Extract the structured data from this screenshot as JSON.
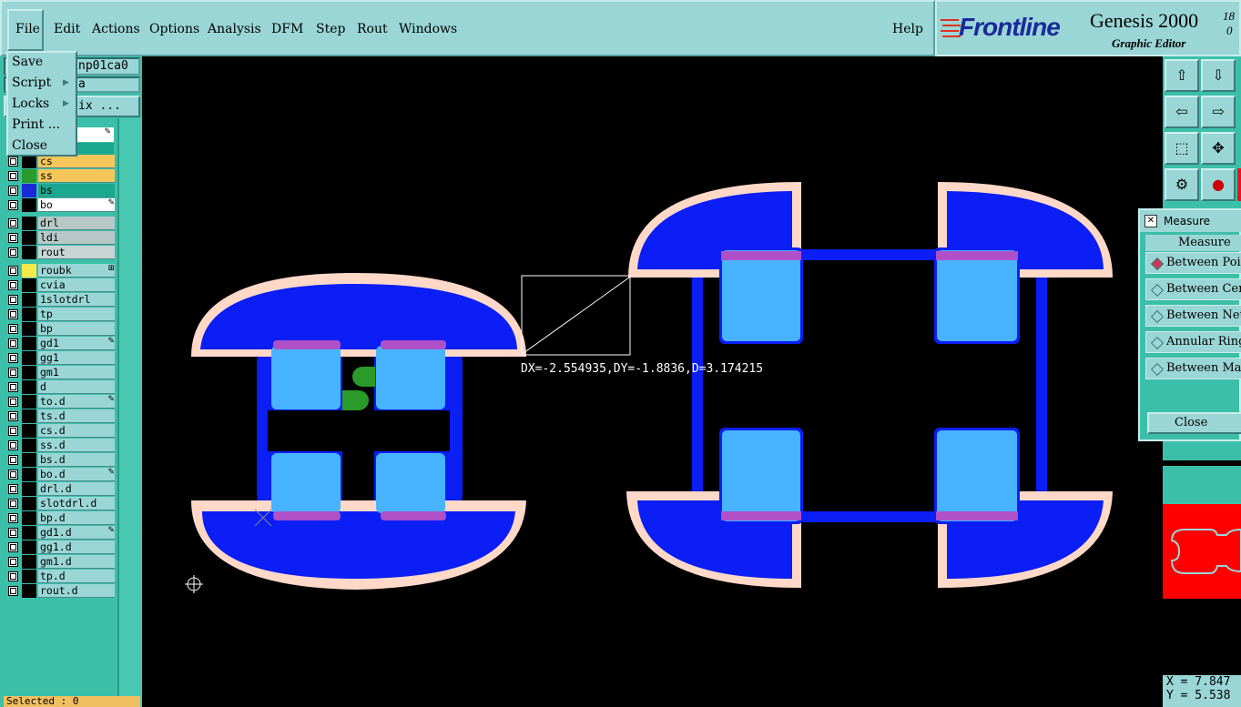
{
  "menubar": {
    "items": [
      {
        "label": "File",
        "underline": "F"
      },
      {
        "label": "Edit",
        "underline": "E"
      },
      {
        "label": "Actions",
        "underline": "A"
      },
      {
        "label": "Options",
        "underline": "O"
      },
      {
        "label": "Analysis",
        "underline": "A"
      },
      {
        "label": "DFM",
        "underline": "D"
      },
      {
        "label": "Step",
        "underline": "S"
      },
      {
        "label": "Rout",
        "underline": "R"
      },
      {
        "label": "Windows",
        "underline": "W"
      }
    ],
    "help": "Help"
  },
  "brand": {
    "logo": "Frontline",
    "product": "Genesis 2000",
    "subtitle": "Graphic Editor",
    "version_top": "18",
    "version_bottom": "0"
  },
  "file_menu": {
    "items": [
      {
        "label": "Save",
        "submenu": false
      },
      {
        "label": "Script",
        "submenu": true
      },
      {
        "label": "Locks",
        "submenu": true
      },
      {
        "label": "Print ...",
        "submenu": false
      },
      {
        "label": "Close",
        "submenu": false
      }
    ]
  },
  "left_panel": {
    "job_field": "np01ca0",
    "step_field": "a",
    "matrix_button": "ix ...",
    "selected_text": "Selected : 0"
  },
  "layers": [
    {
      "name": "cs",
      "color": "#000000",
      "bg": "#f5c65a",
      "flag": ""
    },
    {
      "name": "ss",
      "color": "#2a9a2a",
      "bg": "#f5c65a",
      "flag": ""
    },
    {
      "name": "bs",
      "color": "#1a2ad8",
      "bg": "#1aa890",
      "flag": ""
    },
    {
      "name": "bo",
      "color": "#000000",
      "bg": "#ffffff",
      "flag": "✎"
    },
    {
      "name": "drl",
      "color": "#000000",
      "bg": "#b8c8c8",
      "flag": ""
    },
    {
      "name": "ldi",
      "color": "#000000",
      "bg": "#b8c8c8",
      "flag": ""
    },
    {
      "name": "rout",
      "color": "#000000",
      "bg": "#c8d4d4",
      "flag": ""
    },
    {
      "name": "roubk",
      "color": "#f5e84a",
      "bg": "#9ad6d6",
      "flag": "⊞"
    },
    {
      "name": "cvia",
      "color": "#000000",
      "bg": "#9ad6d6",
      "flag": ""
    },
    {
      "name": "1slotdrl",
      "color": "#000000",
      "bg": "#9ad6d6",
      "flag": ""
    },
    {
      "name": "tp",
      "color": "#000000",
      "bg": "#9ad6d6",
      "flag": ""
    },
    {
      "name": "bp",
      "color": "#000000",
      "bg": "#9ad6d6",
      "flag": ""
    },
    {
      "name": "gd1",
      "color": "#000000",
      "bg": "#9ad6d6",
      "flag": "✎"
    },
    {
      "name": "gg1",
      "color": "#000000",
      "bg": "#9ad6d6",
      "flag": ""
    },
    {
      "name": "gm1",
      "color": "#000000",
      "bg": "#9ad6d6",
      "flag": ""
    },
    {
      "name": "d",
      "color": "#000000",
      "bg": "#9ad6d6",
      "flag": ""
    },
    {
      "name": "to.d",
      "color": "#000000",
      "bg": "#9ad6d6",
      "flag": "✎"
    },
    {
      "name": "ts.d",
      "color": "#000000",
      "bg": "#9ad6d6",
      "flag": ""
    },
    {
      "name": "cs.d",
      "color": "#000000",
      "bg": "#9ad6d6",
      "flag": ""
    },
    {
      "name": "ss.d",
      "color": "#000000",
      "bg": "#9ad6d6",
      "flag": ""
    },
    {
      "name": "bs.d",
      "color": "#000000",
      "bg": "#9ad6d6",
      "flag": ""
    },
    {
      "name": "bo.d",
      "color": "#000000",
      "bg": "#9ad6d6",
      "flag": "✎"
    },
    {
      "name": "drl.d",
      "color": "#000000",
      "bg": "#9ad6d6",
      "flag": ""
    },
    {
      "name": "slotdrl.d",
      "color": "#000000",
      "bg": "#9ad6d6",
      "flag": ""
    },
    {
      "name": "bp.d",
      "color": "#000000",
      "bg": "#9ad6d6",
      "flag": ""
    },
    {
      "name": "gd1.d",
      "color": "#000000",
      "bg": "#9ad6d6",
      "flag": "✎"
    },
    {
      "name": "gg1.d",
      "color": "#000000",
      "bg": "#9ad6d6",
      "flag": ""
    },
    {
      "name": "gm1.d",
      "color": "#000000",
      "bg": "#9ad6d6",
      "flag": ""
    },
    {
      "name": "tp.d",
      "color": "#000000",
      "bg": "#9ad6d6",
      "flag": ""
    },
    {
      "name": "rout.d",
      "color": "#000000",
      "bg": "#9ad6d6",
      "flag": ""
    }
  ],
  "canvas": {
    "measure_readout": "DX=-2.554935,DY=-1.8836,D=3.174215",
    "colors": {
      "outline": "#ffd8c8",
      "copper": "#0a1ef5",
      "pad": "#48b4ff",
      "mask": "#b050c8",
      "green": "#2a9a2a"
    }
  },
  "measure_popup": {
    "title": "Measure Popup",
    "section": "Measure",
    "options": [
      {
        "label": "Between Points",
        "selected": true
      },
      {
        "label": "Between Centers",
        "selected": false
      },
      {
        "label": "Between Nets",
        "selected": false
      },
      {
        "label": "Annular Ring",
        "selected": false
      },
      {
        "label": "Between Mask",
        "selected": false
      }
    ],
    "close_label": "Close"
  },
  "coords": {
    "x": "X = 7.847",
    "y": "Y = 5.538"
  },
  "toolbar": {
    "buttons": [
      "pan-up-icon",
      "pan-down-icon",
      "pan-left-icon",
      "pan-right-icon",
      "zoom-fit-icon",
      "zoom-center-icon",
      "tools-icon",
      "probe-icon"
    ]
  }
}
